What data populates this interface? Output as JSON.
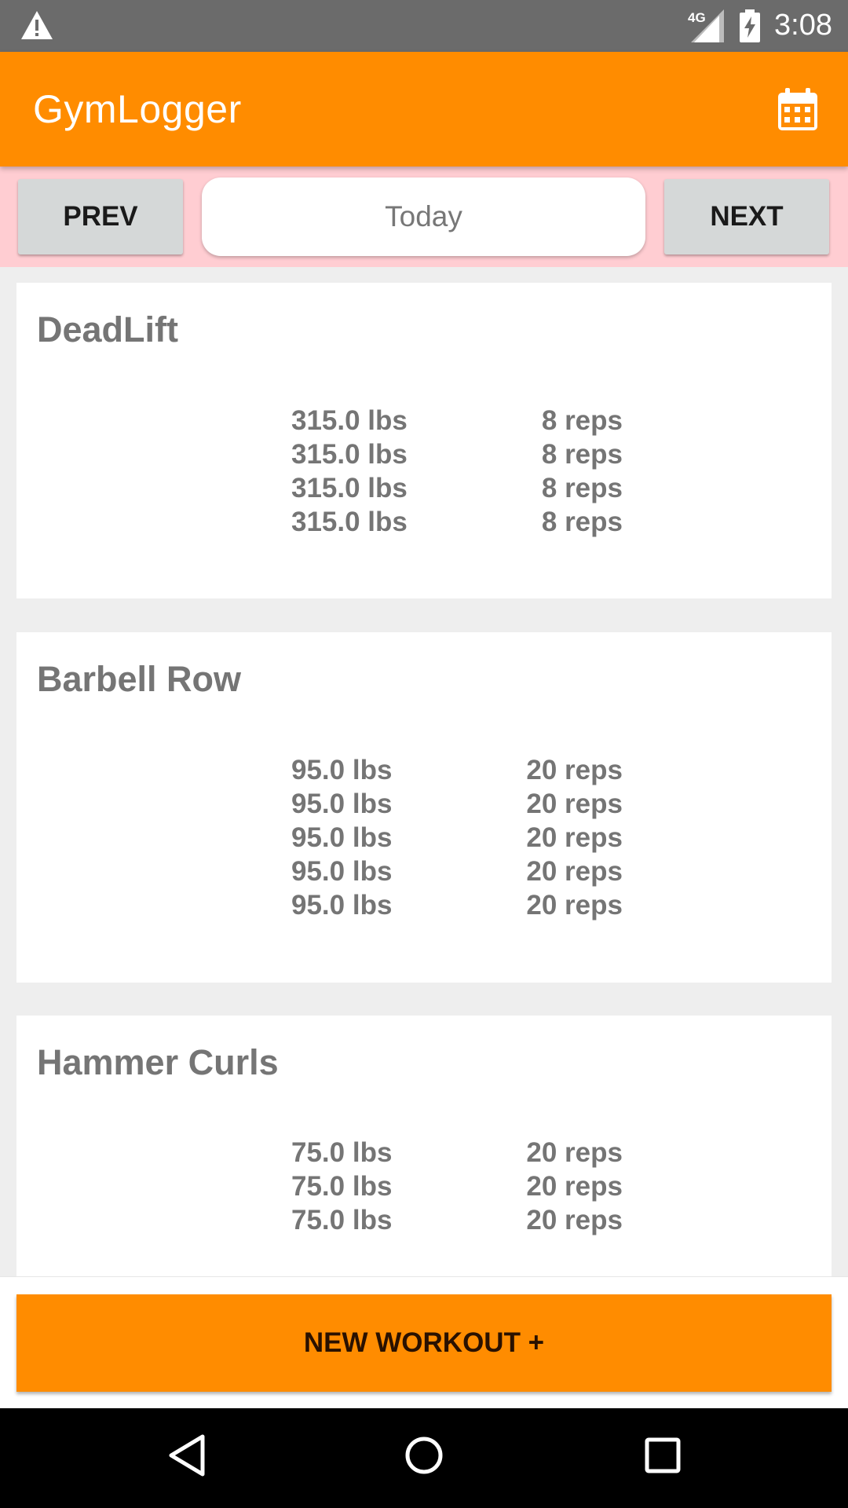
{
  "status_bar": {
    "network": "4G",
    "time": "3:08"
  },
  "app_bar": {
    "title": "GymLogger",
    "calendar_icon": "calendar-icon"
  },
  "date_nav": {
    "prev_label": "PREV",
    "date_label": "Today",
    "next_label": "NEXT"
  },
  "workouts": [
    {
      "name": "DeadLift",
      "sets": [
        {
          "weight": "315.0 lbs",
          "reps": "8 reps"
        },
        {
          "weight": "315.0 lbs",
          "reps": "8 reps"
        },
        {
          "weight": "315.0 lbs",
          "reps": "8 reps"
        },
        {
          "weight": "315.0 lbs",
          "reps": "8 reps"
        }
      ]
    },
    {
      "name": "Barbell Row",
      "sets": [
        {
          "weight": "95.0 lbs",
          "reps": "20 reps"
        },
        {
          "weight": "95.0 lbs",
          "reps": "20 reps"
        },
        {
          "weight": "95.0 lbs",
          "reps": "20 reps"
        },
        {
          "weight": "95.0 lbs",
          "reps": "20 reps"
        },
        {
          "weight": "95.0 lbs",
          "reps": "20 reps"
        }
      ]
    },
    {
      "name": "Hammer Curls",
      "sets": [
        {
          "weight": "75.0 lbs",
          "reps": "20 reps"
        },
        {
          "weight": "75.0 lbs",
          "reps": "20 reps"
        },
        {
          "weight": "75.0 lbs",
          "reps": "20 reps"
        }
      ]
    }
  ],
  "new_workout_label": "NEW WORKOUT +",
  "colors": {
    "accent": "#ff8c00",
    "nav_background": "#ffcdd2",
    "text_gray": "#757575"
  }
}
